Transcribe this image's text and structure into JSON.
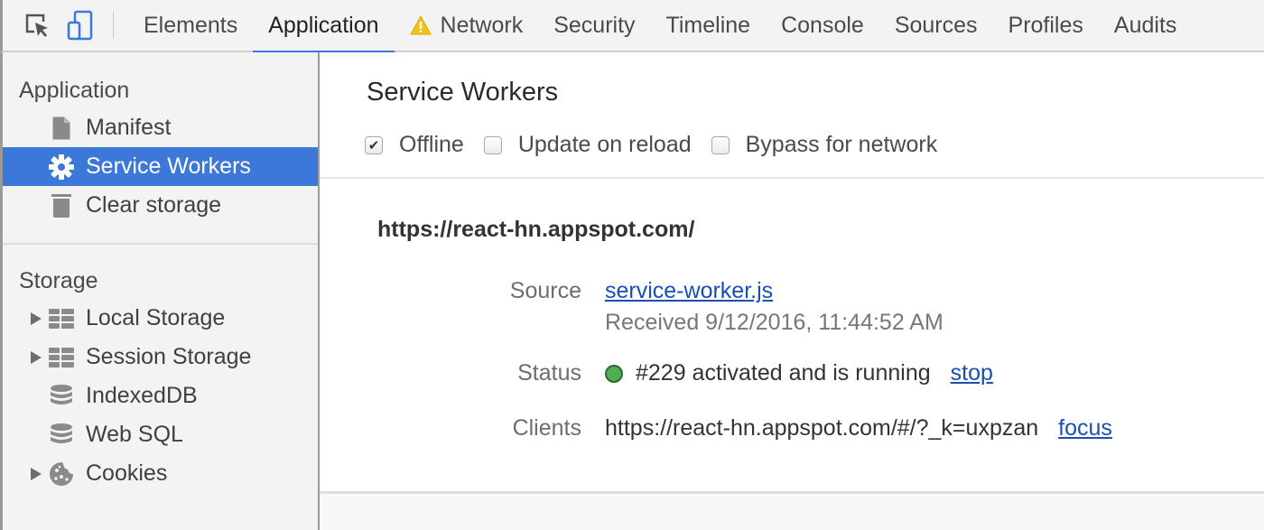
{
  "toolbar": {
    "inspect_icon": "inspect-element-icon",
    "device_icon": "device-mode-icon",
    "tabs": [
      {
        "label": "Elements",
        "active": false,
        "warning": false
      },
      {
        "label": "Application",
        "active": true,
        "warning": false
      },
      {
        "label": "Network",
        "active": false,
        "warning": true
      },
      {
        "label": "Security",
        "active": false,
        "warning": false
      },
      {
        "label": "Timeline",
        "active": false,
        "warning": false
      },
      {
        "label": "Console",
        "active": false,
        "warning": false
      },
      {
        "label": "Sources",
        "active": false,
        "warning": false
      },
      {
        "label": "Profiles",
        "active": false,
        "warning": false
      },
      {
        "label": "Audits",
        "active": false,
        "warning": false
      }
    ]
  },
  "sidebar": {
    "application": {
      "title": "Application",
      "items": [
        {
          "label": "Manifest",
          "icon": "document-icon",
          "selected": false
        },
        {
          "label": "Service Workers",
          "icon": "gear-icon",
          "selected": true
        },
        {
          "label": "Clear storage",
          "icon": "trash-icon",
          "selected": false
        }
      ]
    },
    "storage": {
      "title": "Storage",
      "items": [
        {
          "label": "Local Storage",
          "icon": "grid-icon",
          "expandable": true
        },
        {
          "label": "Session Storage",
          "icon": "grid-icon",
          "expandable": true
        },
        {
          "label": "IndexedDB",
          "icon": "database-icon",
          "expandable": false
        },
        {
          "label": "Web SQL",
          "icon": "database-icon",
          "expandable": false
        },
        {
          "label": "Cookies",
          "icon": "cookie-icon",
          "expandable": true
        }
      ]
    }
  },
  "main": {
    "title": "Service Workers",
    "options": [
      {
        "label": "Offline",
        "checked": true
      },
      {
        "label": "Update on reload",
        "checked": false
      },
      {
        "label": "Bypass for network",
        "checked": false
      }
    ],
    "worker": {
      "origin": "https://react-hn.appspot.com/",
      "source_label": "Source",
      "source_link": "service-worker.js",
      "received": "Received 9/12/2016, 11:44:52 AM",
      "status_label": "Status",
      "status_text": "#229 activated and is running",
      "status_color": "#4caf50",
      "stop_link": "stop",
      "clients_label": "Clients",
      "client_url": "https://react-hn.appspot.com/#/?_k=uxpzan",
      "focus_link": "focus"
    }
  },
  "colors": {
    "accent": "#3c78d8",
    "link": "#1a4fb3",
    "warning": "#f2c21b"
  }
}
